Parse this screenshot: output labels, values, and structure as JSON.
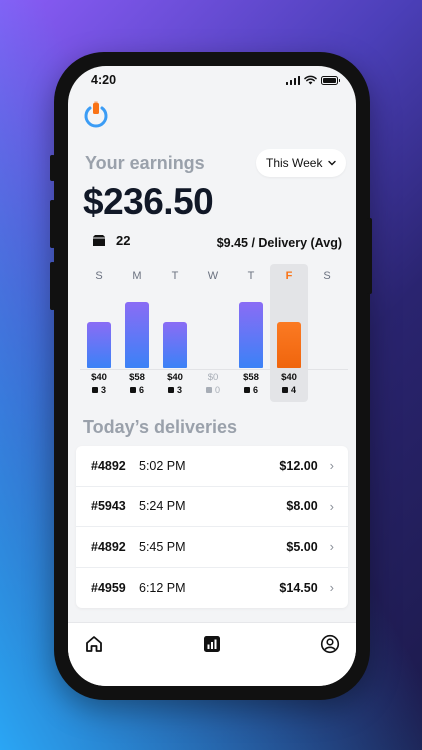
{
  "status": {
    "time": "4:20"
  },
  "earnings": {
    "label": "Your earnings",
    "period": "This Week",
    "amount": "$236.50",
    "deliveries_count": "22",
    "avg": "$9.45 / Delivery (Avg)"
  },
  "chart_data": {
    "type": "bar",
    "categories": [
      "S",
      "M",
      "T",
      "W",
      "T",
      "F",
      "S"
    ],
    "values": [
      40,
      58,
      40,
      0,
      58,
      40,
      null
    ],
    "value_labels": [
      "$40",
      "$58",
      "$40",
      "$0",
      "$58",
      "$40",
      ""
    ],
    "counts": [
      "3",
      "6",
      "3",
      "0",
      "6",
      "4",
      ""
    ],
    "selected_index": 5,
    "colors": {
      "bar": "#6b7cf6",
      "selected": "#f97316"
    }
  },
  "deliveries": {
    "title": "Today’s deliveries",
    "items": [
      {
        "id": "#4892",
        "time": "5:02 PM",
        "amount": "$12.00"
      },
      {
        "id": "#5943",
        "time": "5:24 PM",
        "amount": "$8.00"
      },
      {
        "id": "#4892",
        "time": "5:45 PM",
        "amount": "$5.00"
      },
      {
        "id": "#4959",
        "time": "6:12 PM",
        "amount": "$14.50"
      }
    ]
  },
  "tabs": [
    "home-icon",
    "chart-icon",
    "profile-icon"
  ]
}
